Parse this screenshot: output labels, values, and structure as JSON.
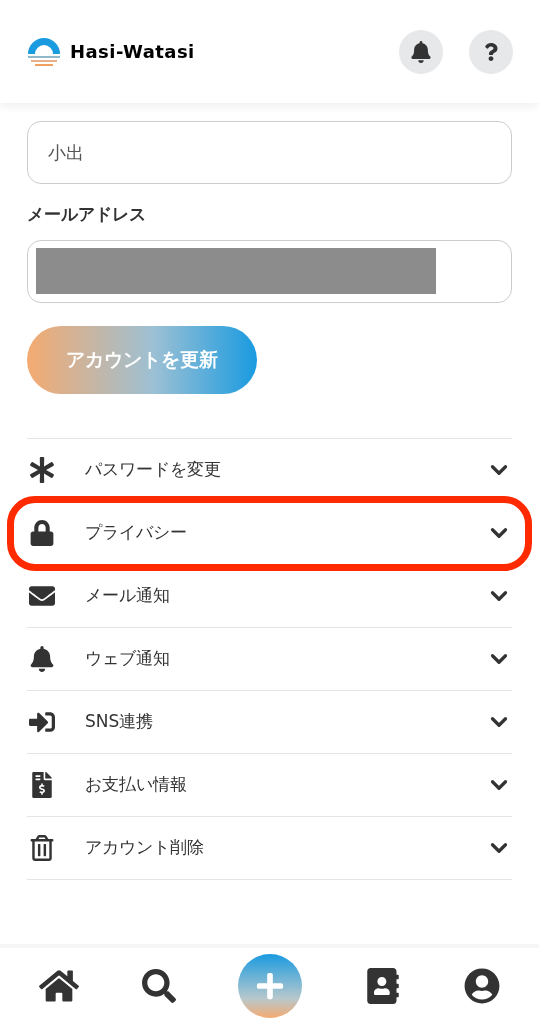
{
  "header": {
    "logo_text": "Hasi-Watasi"
  },
  "form": {
    "name_field": {
      "value": "小出"
    },
    "email_label": "メールアドレス",
    "email_field": {
      "redacted": true
    },
    "submit": "アカウントを更新"
  },
  "settings": [
    {
      "label": "パスワードを変更",
      "expanded": false,
      "highlighted": false
    },
    {
      "label": "プライバシー",
      "expanded": false,
      "highlighted": true
    },
    {
      "label": "メール通知",
      "expanded": false,
      "highlighted": false
    },
    {
      "label": "ウェブ通知",
      "expanded": false,
      "highlighted": false
    },
    {
      "label": "SNS連携",
      "expanded": false,
      "highlighted": false
    },
    {
      "label": "お支払い情報",
      "expanded": false,
      "highlighted": false
    },
    {
      "label": "アカウント削除",
      "expanded": false,
      "highlighted": false
    }
  ]
}
